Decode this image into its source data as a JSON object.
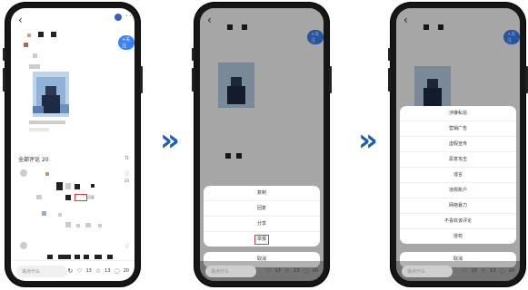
{
  "phone1": {
    "comments_header": "全部评论 20",
    "sort_label": "⇅",
    "follow_label": "+关注",
    "like_count_small": "20",
    "red_box_text": "回复",
    "input_placeholder": "说点什么",
    "likes": "13",
    "favorites": "13",
    "comments": "20"
  },
  "phone2": {
    "sheet_items": [
      "复制",
      "回复",
      "分享",
      "举报"
    ],
    "highlighted_index": 3,
    "cancel_label": "取消",
    "input_placeholder": "说点什么",
    "likes": "13",
    "favorites": "13",
    "comments": "20"
  },
  "phone3": {
    "sheet_items": [
      "涉嫌私信",
      "营销广告",
      "虚假宣传",
      "恶意攻击",
      "谣言",
      "违规账户",
      "网络暴力",
      "不喜欢该评论",
      "侵权"
    ],
    "cancel_label": "取消",
    "input_placeholder": "说点什么",
    "likes": "13",
    "favorites": "13",
    "comments": "20"
  },
  "colors": {
    "accent": "#3b82f6",
    "arrow": "#1c5fae",
    "highlight": "#e53935"
  }
}
